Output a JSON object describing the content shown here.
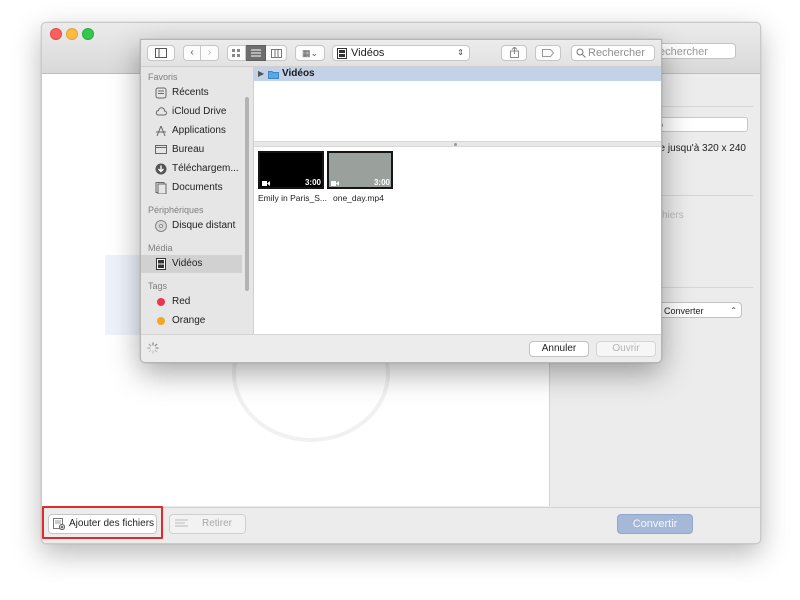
{
  "app": {
    "search_placeholder": "echercher",
    "right_panel": {
      "field_value": "ideo",
      "text_resolution": "ue jusqu'à 320 x 240",
      "text_faded": "hiers",
      "select_value": "Converter"
    },
    "bottom": {
      "add_files_label": "Ajouter des fichiers",
      "remove_label": "Retirer",
      "convert_label": "Convertir"
    }
  },
  "dialog": {
    "toolbar": {
      "location": "Vidéos",
      "search_placeholder": "Rechercher",
      "icons": {
        "sidebar_toggle": "sidebar-icon",
        "back": "chevron-left-icon",
        "forward": "chevron-right-icon",
        "view_icons": "grid-icon",
        "view_list": "list-icon",
        "view_columns": "columns-icon",
        "arrange": "arrange-icon",
        "share": "share-icon",
        "tag": "tag-icon",
        "search": "search-icon"
      }
    },
    "sidebar": {
      "sections": [
        {
          "title": "Favoris",
          "items": [
            {
              "label": "Récents",
              "icon": "recents-icon"
            },
            {
              "label": "iCloud Drive",
              "icon": "cloud-icon"
            },
            {
              "label": "Applications",
              "icon": "applications-icon"
            },
            {
              "label": "Bureau",
              "icon": "desktop-icon"
            },
            {
              "label": "Téléchargem...",
              "icon": "download-icon"
            },
            {
              "label": "Documents",
              "icon": "documents-icon"
            }
          ]
        },
        {
          "title": "Périphériques",
          "items": [
            {
              "label": "Disque distant",
              "icon": "disc-icon"
            }
          ]
        },
        {
          "title": "Média",
          "items": [
            {
              "label": "Vidéos",
              "icon": "film-icon",
              "selected": true
            }
          ]
        },
        {
          "title": "Tags",
          "items": [
            {
              "label": "Red",
              "color": "#e8384f"
            },
            {
              "label": "Orange",
              "color": "#f5a623"
            }
          ]
        }
      ]
    },
    "path": {
      "current": "Vidéos"
    },
    "files": [
      {
        "name": "Emily in Paris_S...",
        "duration": "3:00",
        "thumb_color": "#000000"
      },
      {
        "name": "one_day.mp4",
        "duration": "3:00",
        "thumb_color": "#9aa09b"
      }
    ],
    "buttons": {
      "cancel_label": "Annuler",
      "open_label": "Ouvrir"
    }
  },
  "colors": {
    "highlight": "#e12a2a",
    "selection": "#c4d2e8",
    "convert_button": "#a6b8d8"
  }
}
